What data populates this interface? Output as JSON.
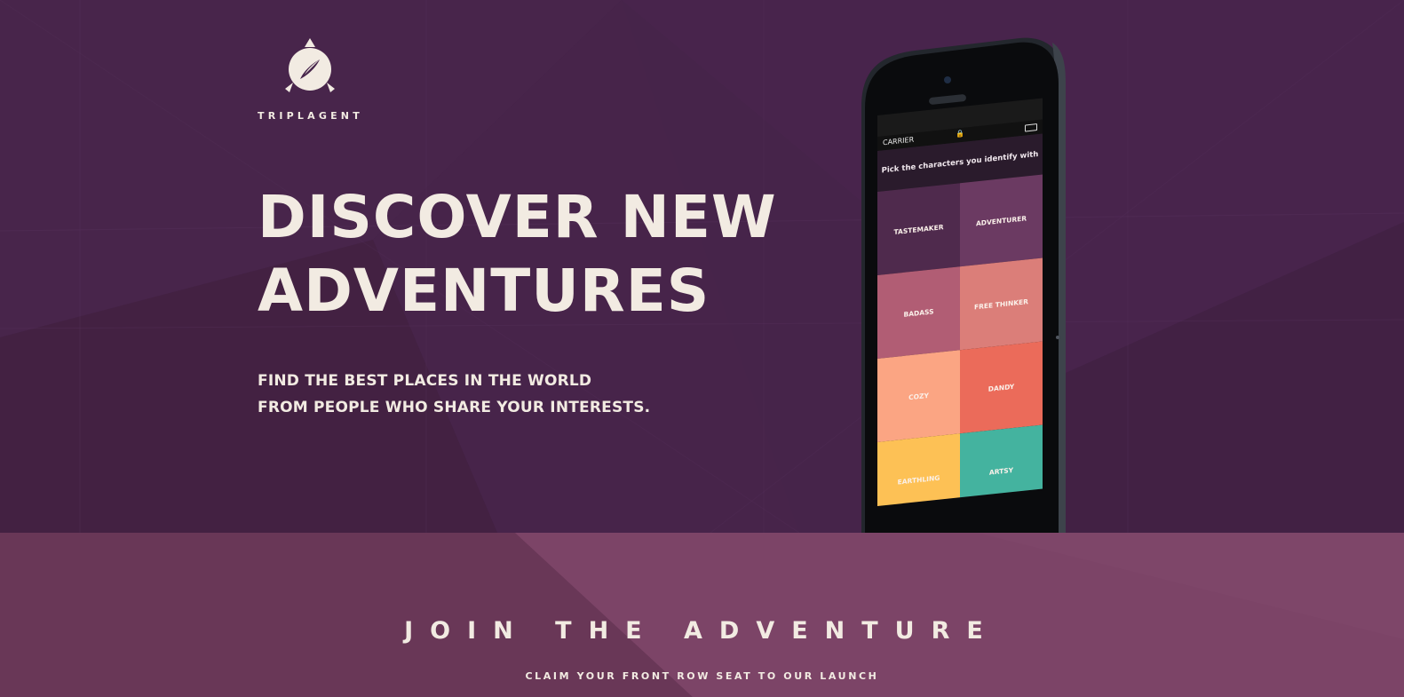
{
  "brand": {
    "name": "TRIPLAGENT",
    "logo_icon": "compass-icon"
  },
  "hero": {
    "headline_line1": "DISCOVER NEW",
    "headline_line2": "ADVENTURES",
    "subhead_line1": "FIND THE BEST PLACES IN THE WORLD",
    "subhead_line2": "FROM PEOPLE WHO SHARE YOUR INTERESTS."
  },
  "phone": {
    "carrier": "CARRIER",
    "prompt": "Pick the characters you identify with",
    "tiles": [
      {
        "label": "TASTEMAKER",
        "color": "#4f2a4d"
      },
      {
        "label": "ADVENTURER",
        "color": "#6b3a62"
      },
      {
        "label": "BADASS",
        "color": "#b15d74"
      },
      {
        "label": "FREE THINKER",
        "color": "#db7e79"
      },
      {
        "label": "COZY",
        "color": "#fba583"
      },
      {
        "label": "DANDY",
        "color": "#eb6b5a"
      },
      {
        "label": "EARTHLING",
        "color": "#fdc155"
      },
      {
        "label": "ARTSY",
        "color": "#44b39f"
      }
    ]
  },
  "cta": {
    "title": "JOIN THE ADVENTURE",
    "subtitle": "CLAIM YOUR FRONT ROW SEAT TO OUR LAUNCH"
  },
  "colors": {
    "hero_bg": "#46244a",
    "band_bg": "#733f63",
    "text": "#f2ebe2"
  }
}
